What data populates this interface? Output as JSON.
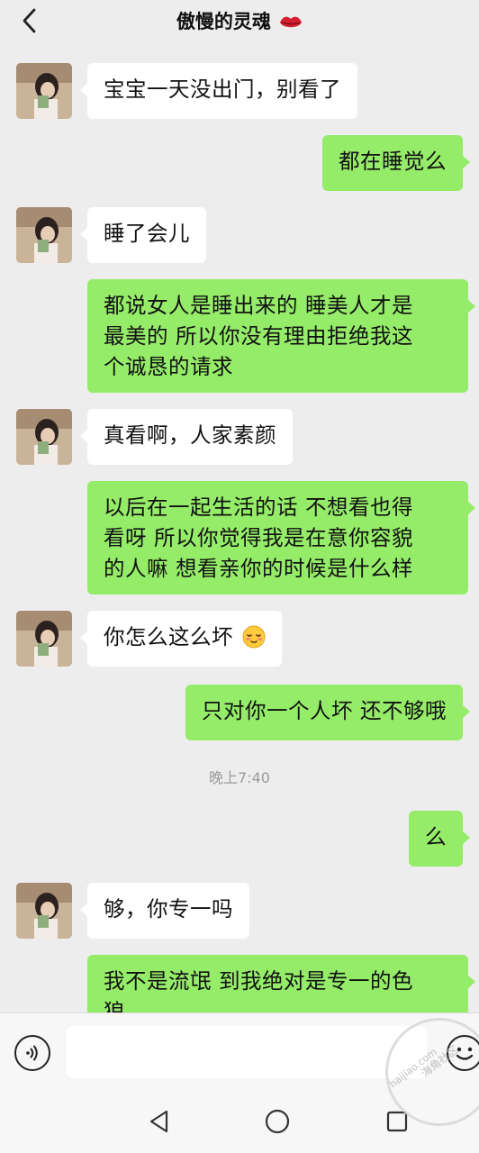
{
  "header": {
    "title": "傲慢的灵魂"
  },
  "messages": [
    {
      "side": "in",
      "text": "宝宝一天没出门，别看了"
    },
    {
      "side": "out",
      "text": "都在睡觉么"
    },
    {
      "side": "in",
      "text": "睡了会儿"
    },
    {
      "side": "out",
      "lines": [
        "都说女人是睡出来的  睡美人才是",
        "最美的  所以你没有理由拒绝我这",
        "个诚恳的请求"
      ]
    },
    {
      "side": "in",
      "text": "真看啊，人家素颜"
    },
    {
      "side": "out",
      "lines": [
        "以后在一起生活的话 不想看也得",
        "看呀  所以你觉得我是在意你容貌",
        "的人嘛  想看亲你的时候是什么样"
      ]
    },
    {
      "side": "in",
      "text": "你怎么这么坏"
    },
    {
      "side": "out",
      "text": "只对你一个人坏 还不够哦"
    },
    {
      "side": "out",
      "text": "么"
    },
    {
      "side": "in",
      "text": "够，你专一吗"
    },
    {
      "side": "out",
      "lines": [
        "我不是流氓 到我绝对是专一的色",
        "狼"
      ]
    }
  ],
  "timestamp": "晚上7:40",
  "input": {
    "value": "",
    "placeholder": ""
  },
  "watermark": {
    "cn": "海角社区",
    "en": "haijiao.com"
  },
  "colors": {
    "background": "#ededed",
    "outgoing_bubble": "#95ec69",
    "incoming_bubble": "#ffffff"
  },
  "icons": {
    "back": "chevron-left-icon",
    "voice": "voice-icon",
    "emoji": "smiley-icon",
    "nav_back": "triangle-back-icon",
    "nav_home": "circle-home-icon",
    "nav_recent": "square-recent-icon"
  }
}
